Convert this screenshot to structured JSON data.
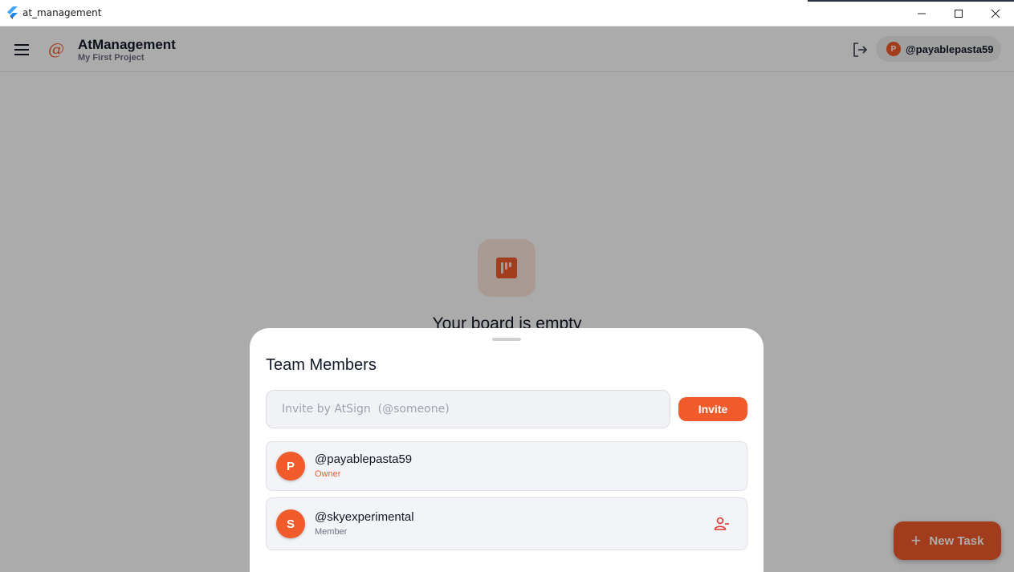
{
  "window": {
    "title": "at_management",
    "app_icon": "flutter-icon",
    "controls": [
      "minimize-icon",
      "maximize-icon",
      "close-icon"
    ]
  },
  "header": {
    "menu_icon": "hamburger-menu-icon",
    "logo_icon": "at-sign-logo",
    "logo_glyph": "@",
    "app_name": "AtManagement",
    "project_name": "My First Project",
    "logout_icon": "logout-icon",
    "user": {
      "avatar_letter": "P",
      "handle": "@payablepasta59"
    }
  },
  "board": {
    "empty_icon": "kanban-board-icon",
    "empty_title": "Your board is empty",
    "fab_icon": "plus-icon",
    "fab_label": "New Task"
  },
  "team_sheet": {
    "title": "Team Members",
    "invite_placeholder": "Invite by AtSign  (@someone)",
    "invite_value": "",
    "invite_button": "Invite",
    "members": [
      {
        "avatar_letter": "P",
        "handle": "@payablepasta59",
        "role": "Owner"
      },
      {
        "avatar_letter": "S",
        "handle": "@skyexperimental",
        "role": "Member",
        "action_icon": "remove-user-icon"
      }
    ]
  },
  "colors": {
    "accent": "#f15a2b",
    "accent_light": "#fde4dc",
    "text_primary": "#111827",
    "text_secondary": "#6b7280",
    "card_bg": "#f3f4f7"
  }
}
